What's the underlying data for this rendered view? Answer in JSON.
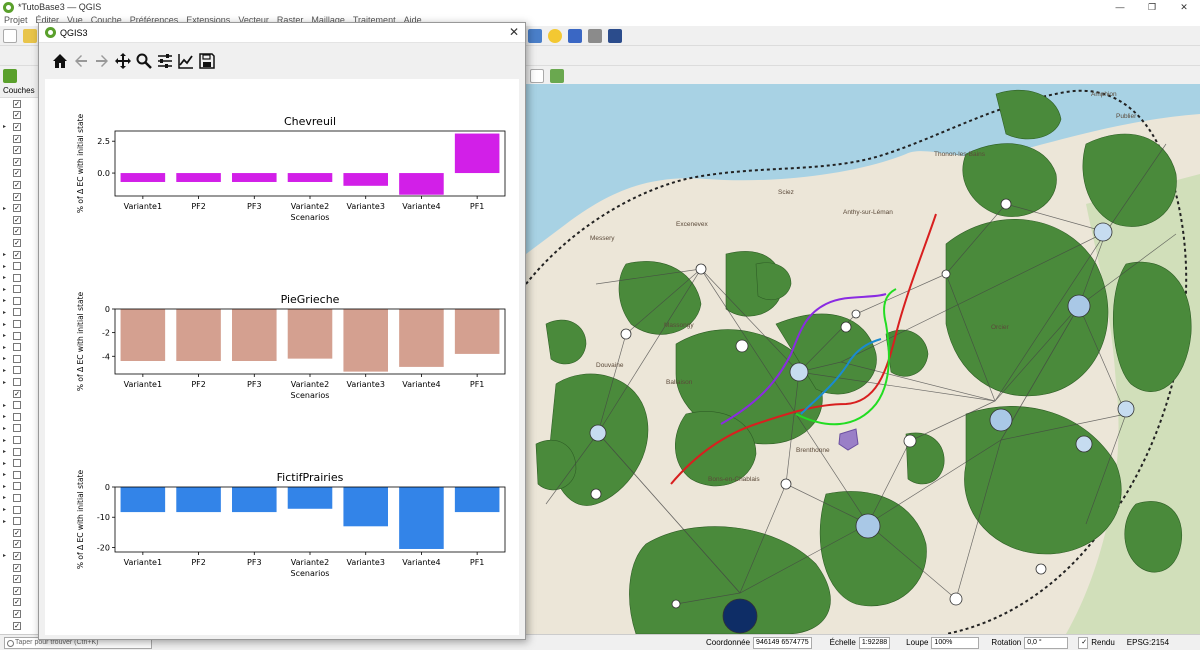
{
  "main_window": {
    "title": "*TutoBase3 — QGIS",
    "menu": [
      "Projet",
      "Éditer",
      "Vue",
      "Couche",
      "Préférences",
      "Extensions",
      "Vecteur",
      "Raster",
      "Maillage",
      "Traitement",
      "Aide"
    ]
  },
  "layers_panel": {
    "title": "Couches"
  },
  "plot_window": {
    "title": "QGIS3"
  },
  "toolbar_icons": [
    "home-icon",
    "back-arrow-icon",
    "forward-arrow-icon",
    "pan-icon",
    "zoom-icon",
    "configure-subplots-icon",
    "edit-axis-icon",
    "save-icon"
  ],
  "colors": {
    "chevreuil": "#d21fe8",
    "piegrieche": "#d4a090",
    "fictif": "#3384e8",
    "map_green": "#4a8a3b",
    "lake": "#a8d2e4"
  },
  "chart_data": [
    {
      "type": "bar",
      "title": "Chevreuil",
      "xlabel": "Scenarios",
      "ylabel": "% of Δ EC with initial state",
      "categories": [
        "Variante1",
        "PF2",
        "PF3",
        "Variante2",
        "Variante3",
        "Variante4",
        "PF1"
      ],
      "values": [
        -0.7,
        -0.7,
        -0.7,
        -0.7,
        -1.0,
        -1.7,
        3.1
      ],
      "ylim": [
        -1.8,
        3.3
      ],
      "yticks": [
        "2.5",
        "0.0"
      ],
      "ytick_values": [
        2.5,
        0.0
      ]
    },
    {
      "type": "bar",
      "title": "PieGrieche",
      "xlabel": "Scenarios",
      "ylabel": "% of Δ EC with initial state",
      "categories": [
        "Variante1",
        "PF2",
        "PF3",
        "Variante2",
        "Variante3",
        "Variante4",
        "PF1"
      ],
      "values": [
        -4.4,
        -4.4,
        -4.4,
        -4.2,
        -5.3,
        -4.9,
        -3.8
      ],
      "ylim": [
        -5.5,
        0
      ],
      "yticks": [
        "0",
        "-2",
        "-4"
      ],
      "ytick_values": [
        0,
        -2,
        -4
      ]
    },
    {
      "type": "bar",
      "title": "FictifPrairies",
      "xlabel": "Scenarios",
      "ylabel": "% of Δ EC with initial state",
      "categories": [
        "Variante1",
        "PF2",
        "PF3",
        "Variante2",
        "Variante3",
        "Variante4",
        "PF1"
      ],
      "values": [
        -8.3,
        -8.3,
        -8.3,
        -7.2,
        -13.0,
        -20.5,
        -8.3
      ],
      "ylim": [
        -21.5,
        0
      ],
      "yticks": [
        "0",
        "-10",
        "-20"
      ],
      "ytick_values": [
        0,
        -10,
        -20
      ]
    }
  ],
  "map": {
    "labels": [
      "Thonon-les-Bains",
      "Anthy-sur-Léman",
      "Messery",
      "Excenevex",
      "Douvaine",
      "Massongy",
      "Ballaison",
      "Brenthonne",
      "Bons-en-Chablais",
      "Sciez",
      "Orcier",
      "Publier",
      "Amphion"
    ]
  },
  "statusbar": {
    "search_placeholder": "Taper pour trouver (Ctrl+K)",
    "coord_label": "Coordonnée",
    "coord_value": "946149 6574775",
    "scale_label": "Échelle",
    "scale_value": "1:92288",
    "magnifier_label": "Loupe",
    "magnifier_value": "100%",
    "rotation_label": "Rotation",
    "rotation_value": "0,0 °",
    "render_label": "Rendu",
    "crs": "EPSG:2154"
  }
}
